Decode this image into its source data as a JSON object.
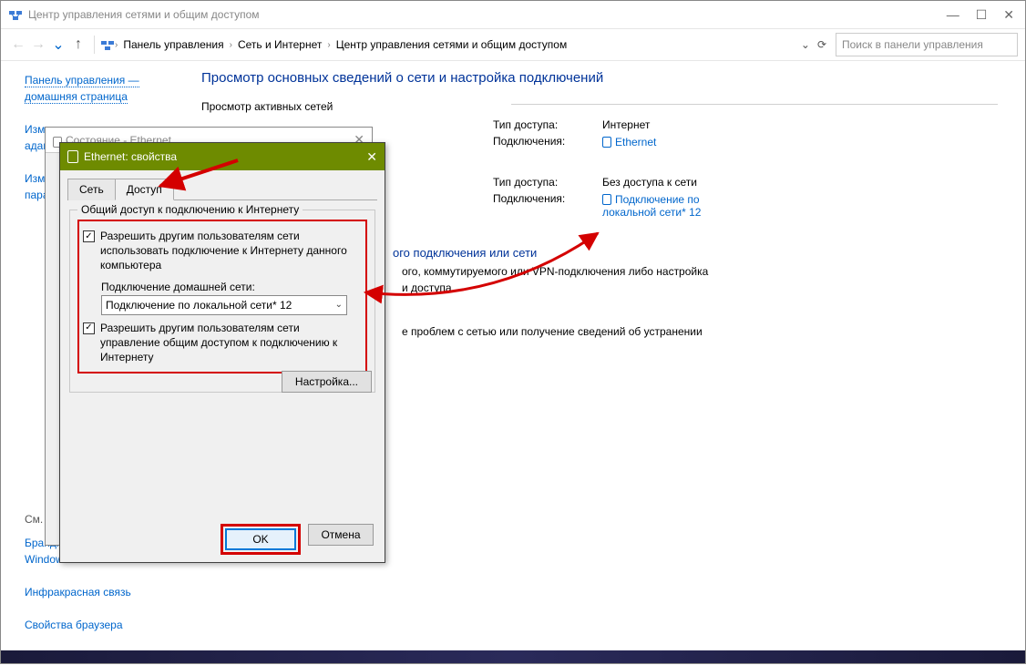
{
  "window": {
    "title": "Центр управления сетями и общим доступом",
    "controls": {
      "min": "—",
      "max": "☐",
      "close": "✕"
    }
  },
  "nav": {
    "back": "←",
    "forward": "→",
    "up": "↑",
    "crumbs": [
      "Панель управления",
      "Сеть и Интернет",
      "Центр управления сетями и общим доступом"
    ],
    "caret": "›",
    "dropdown": "⌄",
    "refresh": "⟳",
    "search_placeholder": "Поиск в панели управления"
  },
  "left": {
    "home_l1": "Панель управления —",
    "home_l2": "домашняя страница",
    "adapter_l1": "Изменение параметров",
    "adapter_l2": "адаптера",
    "sharing_l1": "Изменение",
    "sharing_l2": "параметров",
    "see_also": "См. также",
    "firewall_l1": "Брандмауэр Защитника",
    "firewall_l2": "Windows",
    "infrared": "Инфракрасная связь",
    "inetopt": "Свойства браузера"
  },
  "main": {
    "heading": "Просмотр основных сведений о сети и настройка подключений",
    "active_networks": "Просмотр активных сетей",
    "labels": {
      "access_type": "Тип доступа:",
      "connections": "Подключения:"
    },
    "net1": {
      "access": "Интернет",
      "conn": "Ethernet"
    },
    "net2": {
      "access": "Без доступа к сети",
      "conn_l1": "Подключение по",
      "conn_l2": "локальной сети* 12"
    },
    "change_settings_head_tail": "ого подключения или сети",
    "change_settings_para_l1": "ого, коммутируемого или VPN-подключения либо настройка",
    "change_settings_para_l2": "и доступа.",
    "troubleshoot_para": "е проблем с сетью или получение сведений об устранении"
  },
  "under_dialog": {
    "title": "Состояние - Ethernet",
    "close": "✕"
  },
  "dialog": {
    "title": "Ethernet: свойства",
    "close": "✕",
    "tabs": {
      "net": "Сеть",
      "access": "Доступ"
    },
    "group_legend": "Общий доступ к подключению к Интернету",
    "chk1": "Разрешить другим пользователям сети использовать подключение к Интернету данного компьютера",
    "combo_label": "Подключение домашней сети:",
    "combo_value": "Подключение по локальной сети* 12",
    "chk2": "Разрешить другим пользователям сети управление общим доступом к подключению к Интернету",
    "settings_btn": "Настройка...",
    "ok": "OK",
    "cancel": "Отмена"
  }
}
